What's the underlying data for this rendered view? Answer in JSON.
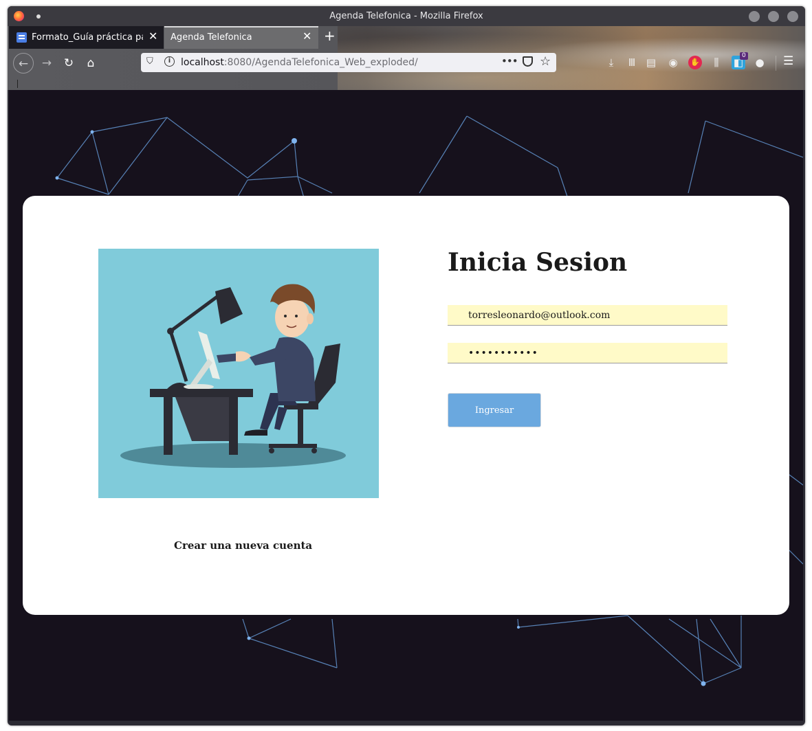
{
  "window": {
    "title": "Agenda Telefonica - Mozilla Firefox"
  },
  "tabs": [
    {
      "label": "Formato_Guía práctica par",
      "active": false
    },
    {
      "label": "Agenda Telefonica",
      "active": true
    }
  ],
  "toolbar": {
    "url_host": "localhost",
    "url_rest": ":8080/AgendaTelefonica_Web_exploded/",
    "more_label": "•••",
    "new_tab_label": "+",
    "extension_badge": "0",
    "menu_label": "☰"
  },
  "login": {
    "title": "Inicia Sesion",
    "email_value": "torresleonardo@outlook.com",
    "password_value": "•••••••••••",
    "submit_label": "Ingresar",
    "create_account_label": "Crear una nueva cuenta"
  },
  "colors": {
    "page_background": "#16111c",
    "card_background": "#ffffff",
    "network_lines": "#5f8fc8",
    "illustration_bg": "#80cbda",
    "input_fill": "#fffac8",
    "button_fill": "#6aa8df"
  }
}
